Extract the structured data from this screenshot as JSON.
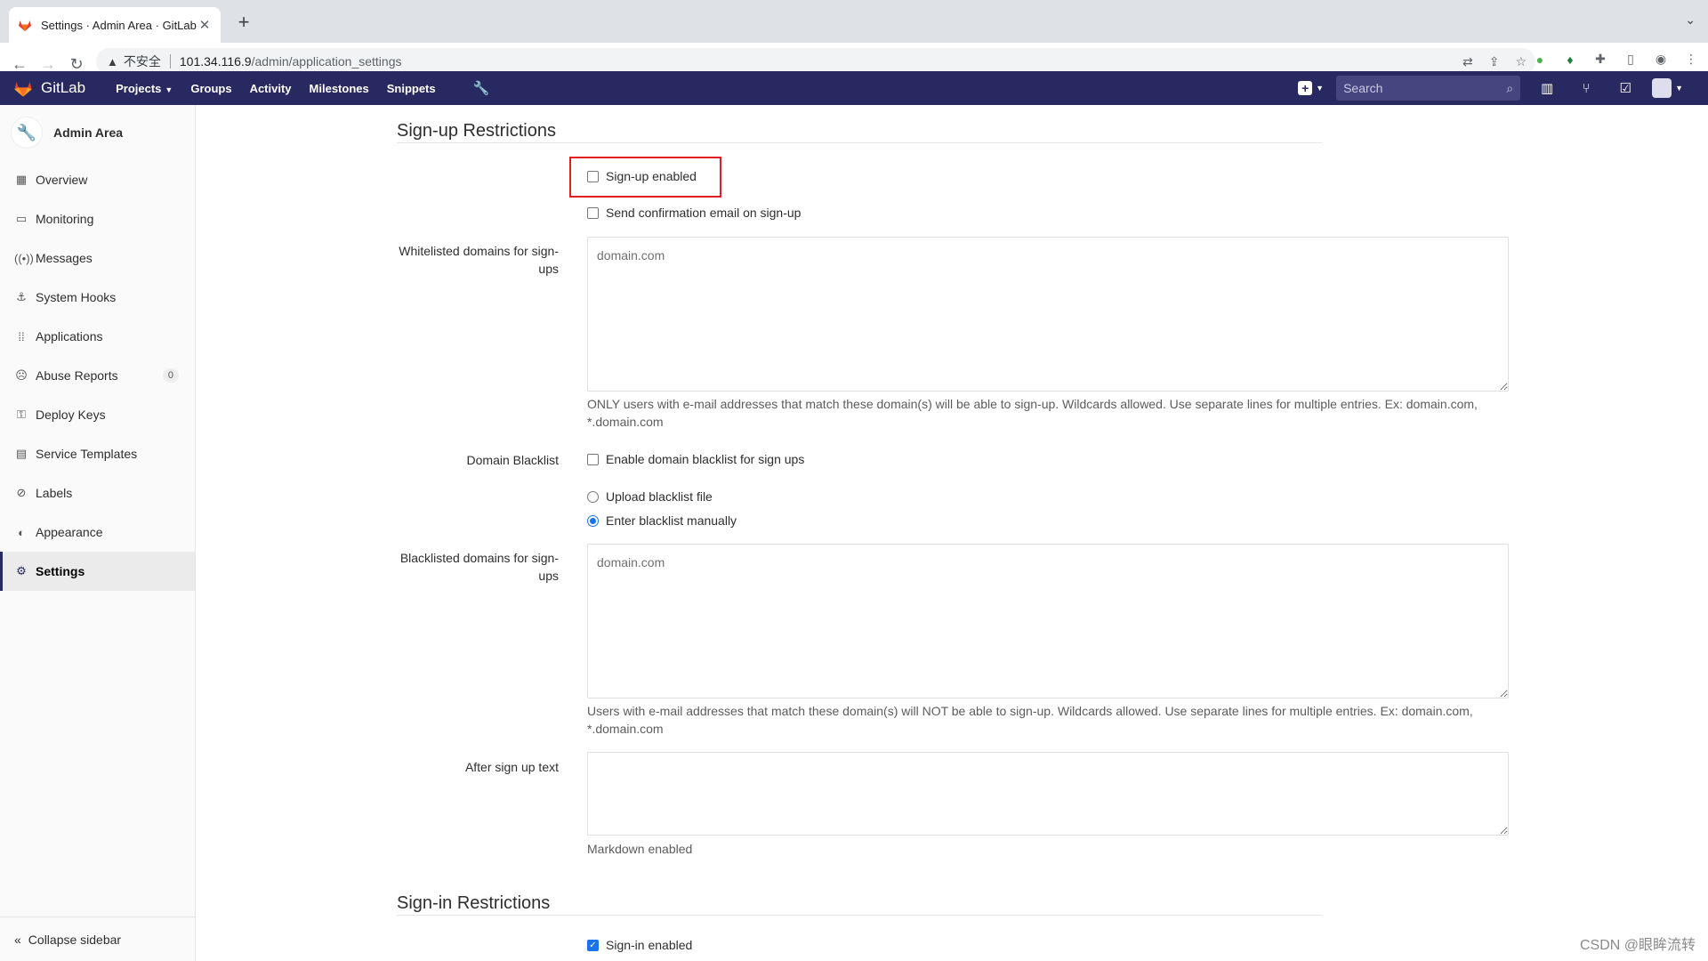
{
  "browser": {
    "tab_title": "Settings · Admin Area · GitLab",
    "insecure_label": "不安全",
    "url_host": "101.34.116.9",
    "url_path": "/admin/application_settings"
  },
  "gitlab_header": {
    "brand": "GitLab",
    "nav": [
      "Projects",
      "Groups",
      "Activity",
      "Milestones",
      "Snippets"
    ],
    "search_placeholder": "Search"
  },
  "sidebar": {
    "context_title": "Admin Area",
    "items": [
      {
        "label": "Overview",
        "icon": "overview-icon"
      },
      {
        "label": "Monitoring",
        "icon": "monitoring-icon"
      },
      {
        "label": "Messages",
        "icon": "messages-icon"
      },
      {
        "label": "System Hooks",
        "icon": "hook-icon"
      },
      {
        "label": "Applications",
        "icon": "applications-icon"
      },
      {
        "label": "Abuse Reports",
        "icon": "abuse-icon",
        "badge": "0"
      },
      {
        "label": "Deploy Keys",
        "icon": "key-icon"
      },
      {
        "label": "Service Templates",
        "icon": "template-icon"
      },
      {
        "label": "Labels",
        "icon": "labels-icon"
      },
      {
        "label": "Appearance",
        "icon": "appearance-icon"
      },
      {
        "label": "Settings",
        "icon": "settings-icon",
        "active": true
      }
    ],
    "collapse_label": "Collapse sidebar"
  },
  "signup": {
    "title": "Sign-up Restrictions",
    "signup_enabled_label": "Sign-up enabled",
    "signup_enabled": false,
    "send_confirmation_label": "Send confirmation email on sign-up",
    "send_confirmation": false,
    "whitelist_label": "Whitelisted domains for sign-ups",
    "whitelist_placeholder": "domain.com",
    "whitelist_help": "ONLY users with e-mail addresses that match these domain(s) will be able to sign-up. Wildcards allowed. Use separate lines for multiple entries. Ex: domain.com, *.domain.com",
    "domain_blacklist_label": "Domain Blacklist",
    "enable_blacklist_label": "Enable domain blacklist for sign ups",
    "enable_blacklist": false,
    "upload_blacklist_label": "Upload blacklist file",
    "enter_blacklist_label": "Enter blacklist manually",
    "blacklist_mode": "manual",
    "blacklisted_label": "Blacklisted domains for sign-ups",
    "blacklisted_placeholder": "domain.com",
    "blacklisted_help": "Users with e-mail addresses that match these domain(s) will NOT be able to sign-up. Wildcards allowed. Use separate lines for multiple entries. Ex: domain.com, *.domain.com",
    "after_signup_label": "After sign up text",
    "after_signup_value": "",
    "markdown_help": "Markdown enabled"
  },
  "signin": {
    "title": "Sign-in Restrictions",
    "signin_enabled_label": "Sign-in enabled",
    "signin_enabled": true
  },
  "watermark": "CSDN @眼眸流转",
  "colors": {
    "header_bg": "#292961",
    "highlight_border": "#e02020",
    "checkbox_accent": "#1a73e8"
  }
}
